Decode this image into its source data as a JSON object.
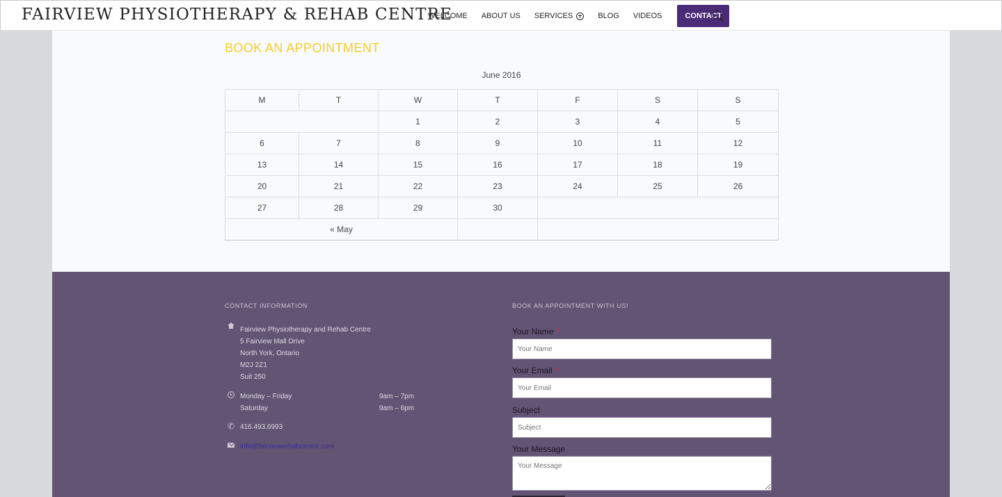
{
  "header": {
    "logo": "FAIRVIEW PHYSIOTHERAPY & REHAB CENTRE",
    "nav": [
      {
        "label": "WELCOME"
      },
      {
        "label": "ABOUT US"
      },
      {
        "label": "SERVICES"
      },
      {
        "label": "BLOG"
      },
      {
        "label": "VIDEOS"
      }
    ],
    "contact_label": "CONTACT",
    "search_icon": "search-icon",
    "services_icon": "plus-circle-icon",
    "accent_color": "#4b2a77"
  },
  "booking": {
    "title": "BOOK AN APPOINTMENT",
    "title_color": "#f4cf2a",
    "calendar": {
      "caption": "June 2016",
      "weekdays": [
        "M",
        "T",
        "W",
        "T",
        "F",
        "S",
        "S"
      ],
      "weeks": [
        [
          "",
          "",
          "1",
          "2",
          "3",
          "4",
          "5"
        ],
        [
          "6",
          "7",
          "8",
          "9",
          "10",
          "11",
          "12"
        ],
        [
          "13",
          "14",
          "15",
          "16",
          "17",
          "18",
          "19"
        ],
        [
          "20",
          "21",
          "22",
          "23",
          "24",
          "25",
          "26"
        ],
        [
          "27",
          "28",
          "29",
          "30",
          "",
          "",
          ""
        ]
      ],
      "prev_link": "« May"
    }
  },
  "footer": {
    "background": "#625574",
    "contact": {
      "heading": "CONTACT INFORMATION",
      "address": [
        "Fairview Physiotherapy and Rehab Centre",
        "5 Fairview Mall Drive",
        "North York, Ontario",
        "M2J 2Z1",
        "Suit 250"
      ],
      "hours": [
        {
          "days": "Monday – Friday",
          "time": "9am – 7pm"
        },
        {
          "days": "Saturday",
          "time": "9am – 6pm"
        }
      ],
      "phone": "416.493.6993",
      "email": "info@fairviewrehabcentre.com",
      "icons": [
        "home-icon",
        "clock-icon",
        "phone-icon",
        "mail-icon"
      ]
    },
    "form": {
      "heading": "BOOK AN APPOINTMENT WITH US!",
      "name_label": "Your Name",
      "name_placeholder": "Your Name",
      "email_label": "Your Email",
      "email_placeholder": "Your Email",
      "subject_label": "Subject",
      "subject_placeholder": "Subject",
      "message_label": "Your Message",
      "message_placeholder": "Your Message",
      "required_mark": "*"
    }
  }
}
